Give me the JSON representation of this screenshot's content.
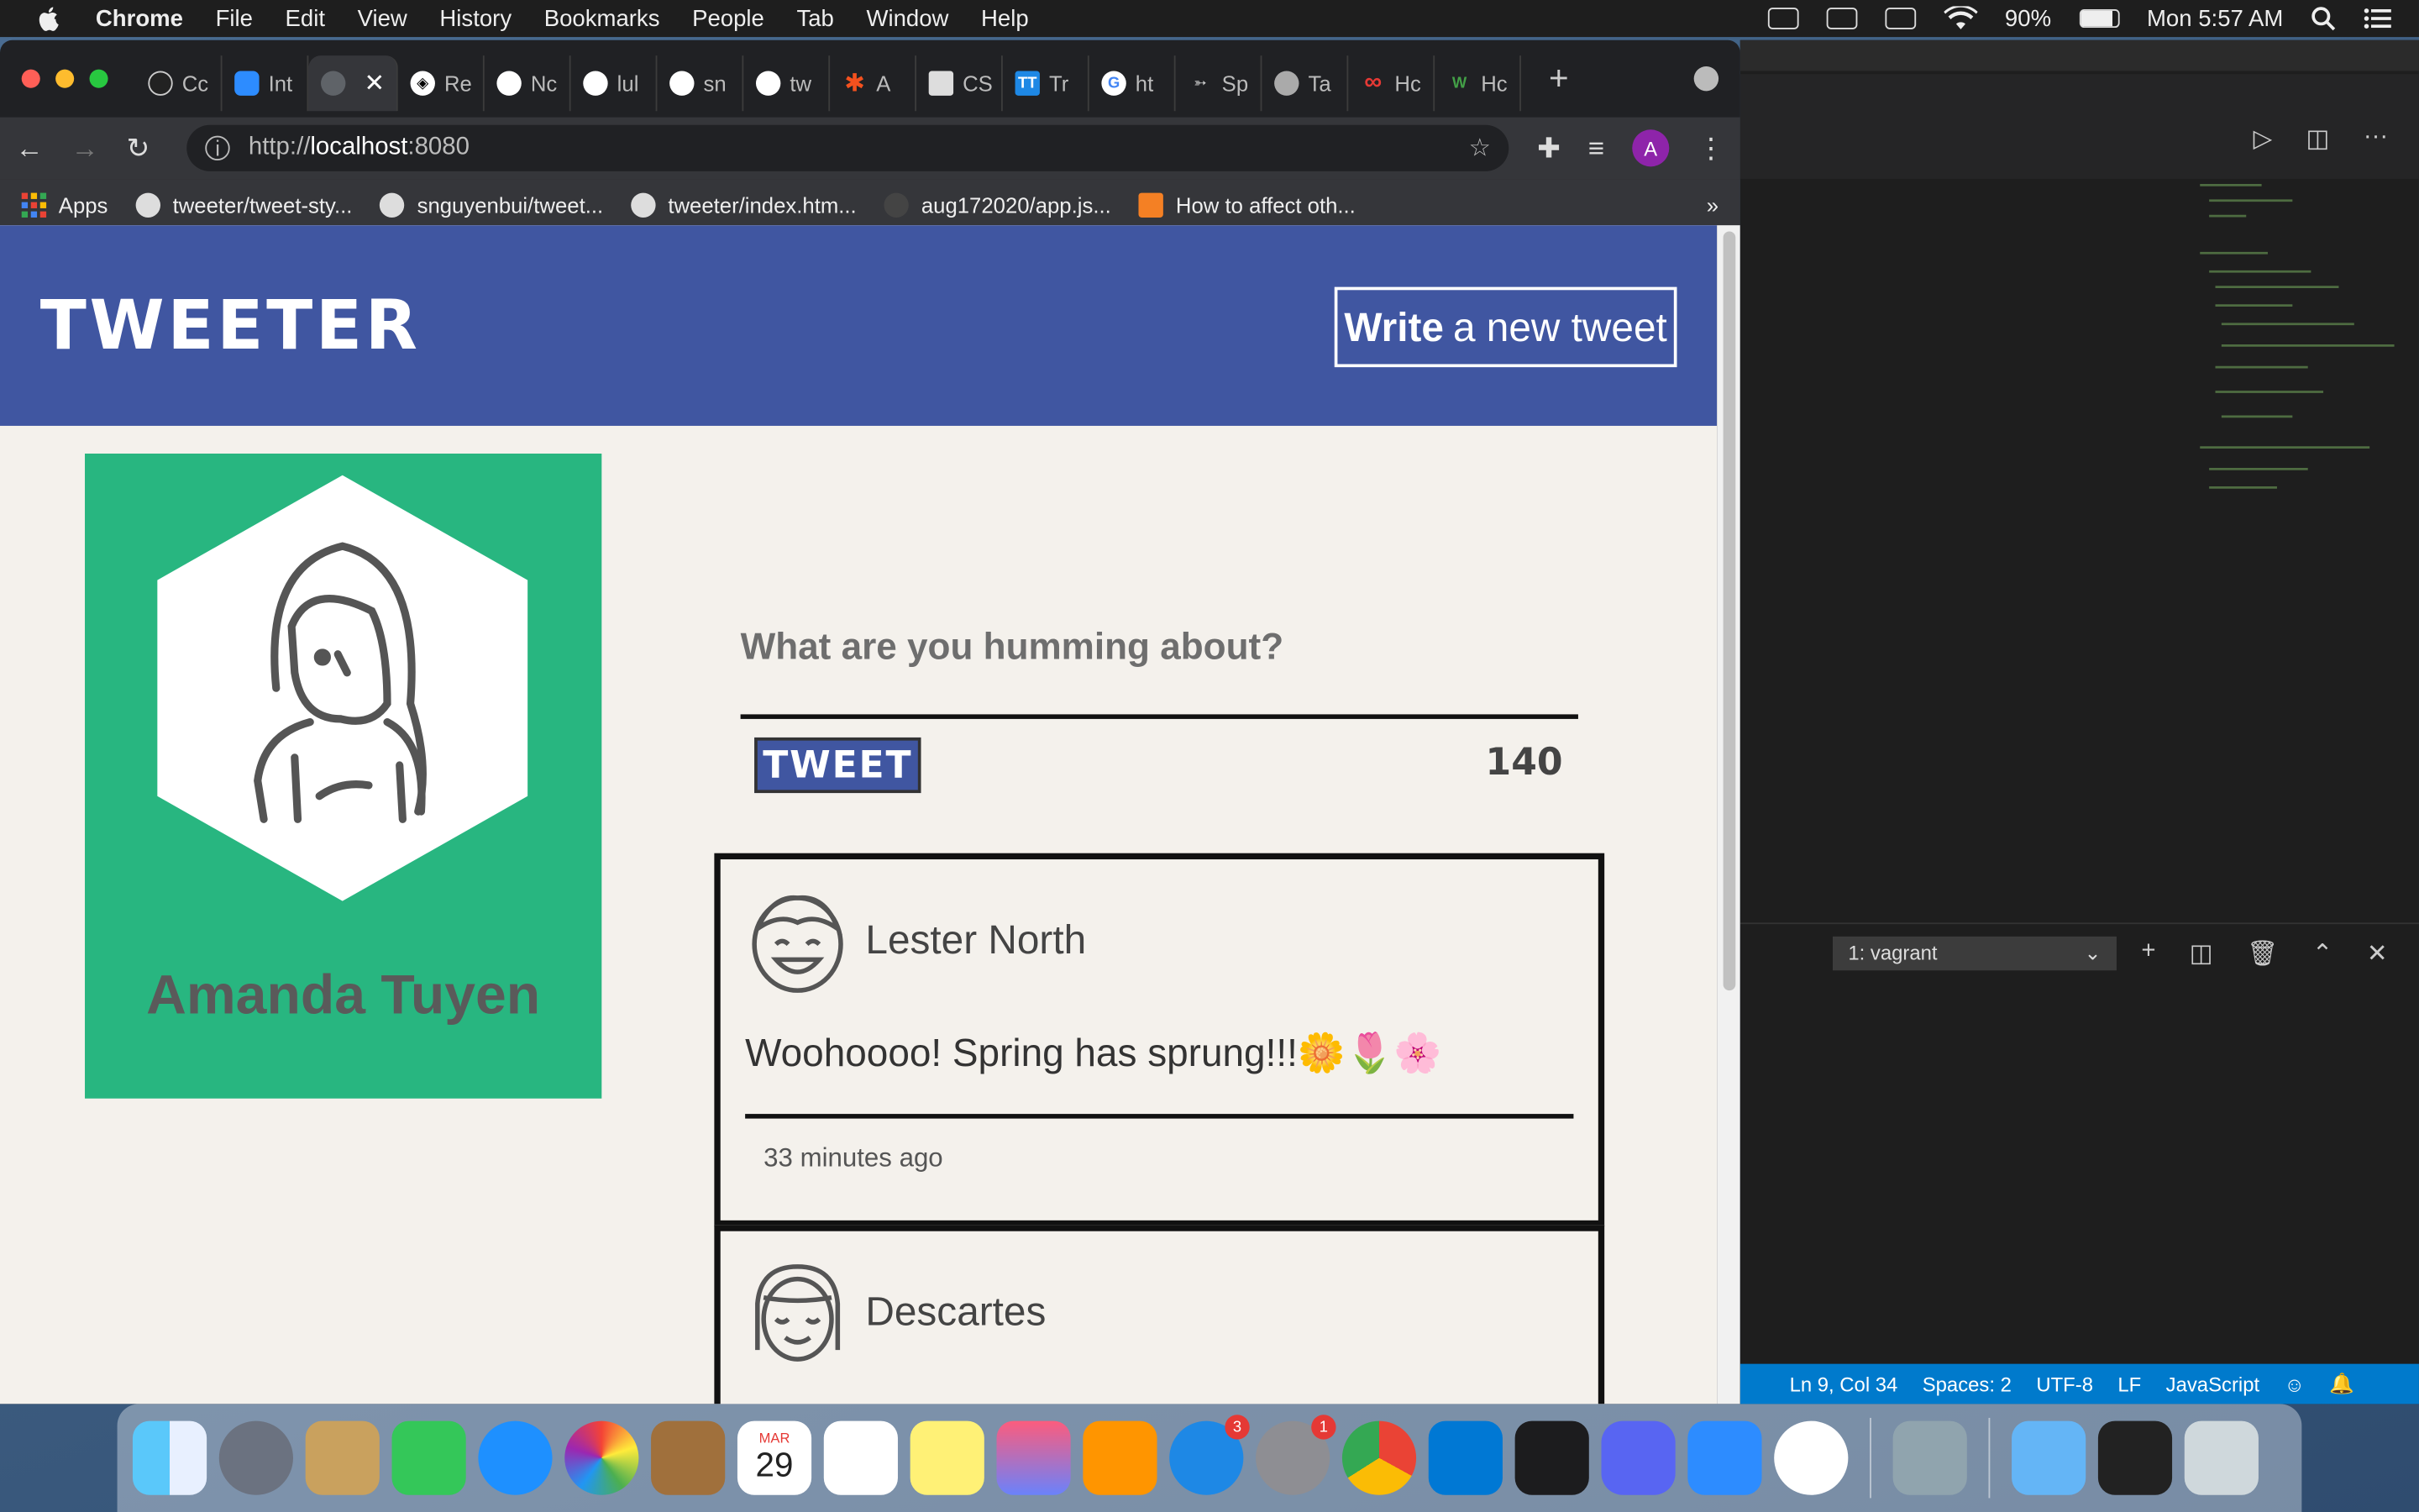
{
  "menubar": {
    "app": "Chrome",
    "items": [
      "File",
      "Edit",
      "View",
      "History",
      "Bookmarks",
      "People",
      "Tab",
      "Window",
      "Help"
    ],
    "battery": "90%",
    "clock": "Mon 5:57 AM"
  },
  "browser": {
    "tabs": [
      {
        "label": "Cc",
        "icon": "circle-icon"
      },
      {
        "label": "Int",
        "icon": "zoom-icon"
      },
      {
        "label": "",
        "icon": "loading-icon",
        "active": true
      },
      {
        "label": "Re",
        "icon": "react-icon"
      },
      {
        "label": "Nc",
        "icon": "github-icon"
      },
      {
        "label": "lul",
        "icon": "github-icon"
      },
      {
        "label": "sn",
        "icon": "github-icon"
      },
      {
        "label": "tw",
        "icon": "github-icon"
      },
      {
        "label": "A",
        "icon": "asterisk-icon"
      },
      {
        "label": "CS",
        "icon": "image-icon"
      },
      {
        "label": "Tr",
        "icon": "tt-icon"
      },
      {
        "label": "ht",
        "icon": "google-icon"
      },
      {
        "label": "Sp",
        "icon": "bird-icon"
      },
      {
        "label": "Ta",
        "icon": "apple-icon"
      },
      {
        "label": "Hc",
        "icon": "infinity-icon"
      },
      {
        "label": "Hc",
        "icon": "w-icon"
      }
    ],
    "url_scheme": "http://",
    "url_host": "localhost",
    "url_port": ":8080",
    "profile_initial": "A",
    "bookmarks": [
      {
        "label": "Apps"
      },
      {
        "label": "tweeter/tweet-sty..."
      },
      {
        "label": "snguyenbui/tweet..."
      },
      {
        "label": "tweeter/index.htm..."
      },
      {
        "label": "aug172020/app.js..."
      },
      {
        "label": "How to affect oth..."
      }
    ],
    "more_bookmarks": "»"
  },
  "page": {
    "brand": "TWEETER",
    "write_bold": "Write",
    "write_rest": "a new tweet",
    "profile_name": "Amanda Tuyen",
    "composer_placeholder": "What are you humming about?",
    "tweet_button": "TWEET",
    "counter": "140",
    "tweets": [
      {
        "author": "Lester North",
        "content": "Woohoooo! Spring has sprung!!!🌼🌷🌸",
        "time": "33 minutes ago"
      },
      {
        "author": "Descartes",
        "content": "",
        "time": ""
      }
    ]
  },
  "vscode": {
    "terminal_select": "1: vagrant",
    "status": [
      "Ln 9, Col 34",
      "Spaces: 2",
      "UTF-8",
      "LF",
      "JavaScript"
    ]
  },
  "dock": {
    "calendar_month": "MAR",
    "calendar_day": "29",
    "badges": {
      "appstore": "3",
      "settings": "1"
    }
  },
  "colors": {
    "nav": "#4056a1",
    "profile": "#28b680",
    "page_bg": "#f4f1ec"
  }
}
